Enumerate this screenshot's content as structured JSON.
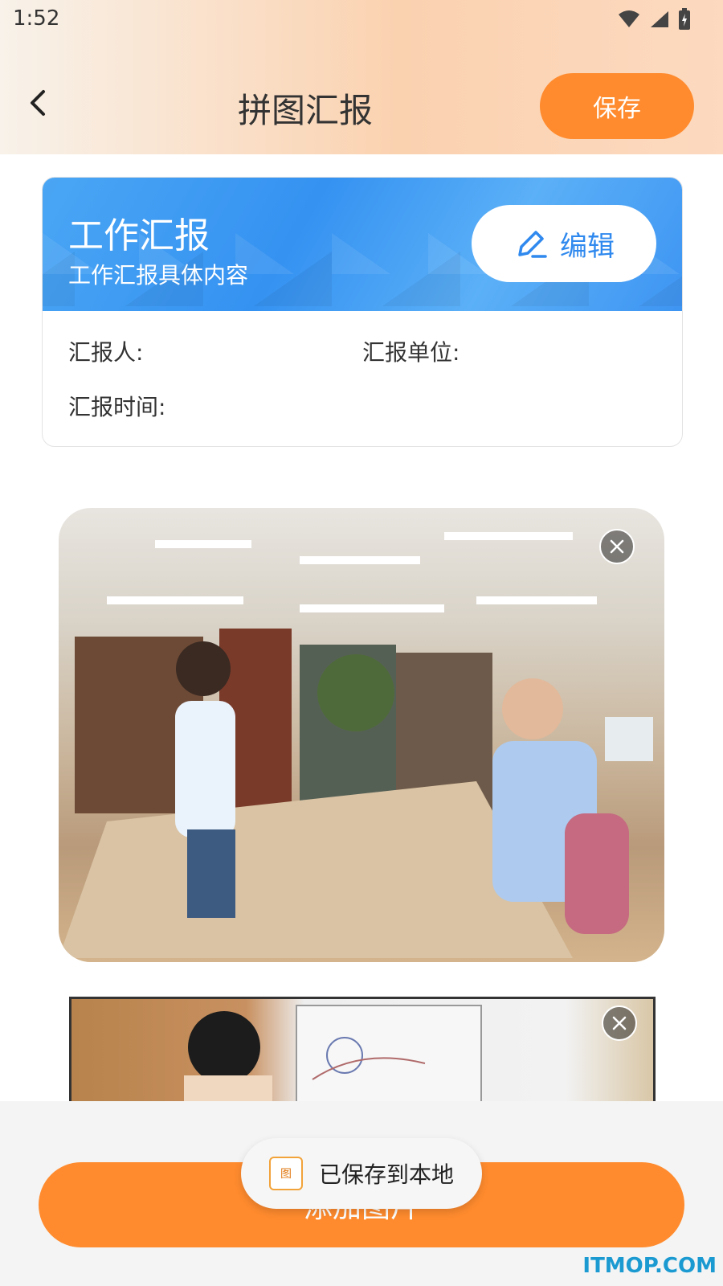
{
  "status_bar": {
    "time": "1:52"
  },
  "header": {
    "title": "拼图汇报",
    "save_label": "保存"
  },
  "report_card": {
    "title": "工作汇报",
    "subtitle": "工作汇报具体内容",
    "edit_label": "编辑",
    "fields": {
      "reporter_label": "汇报人:",
      "unit_label": "汇报单位:",
      "time_label": "汇报时间:"
    }
  },
  "photos": [
    {
      "icon": "library-scene-photo"
    },
    {
      "icon": "whiteboard-scene-photo"
    }
  ],
  "bottom": {
    "add_label": "添加图片"
  },
  "toast": {
    "message": "已保存到本地",
    "icon_text": "图"
  },
  "watermark": "ITMOP.COM",
  "colors": {
    "accent_orange": "#ff8b2e",
    "card_blue": "#3592f1",
    "edit_text_blue": "#2f89ee"
  }
}
